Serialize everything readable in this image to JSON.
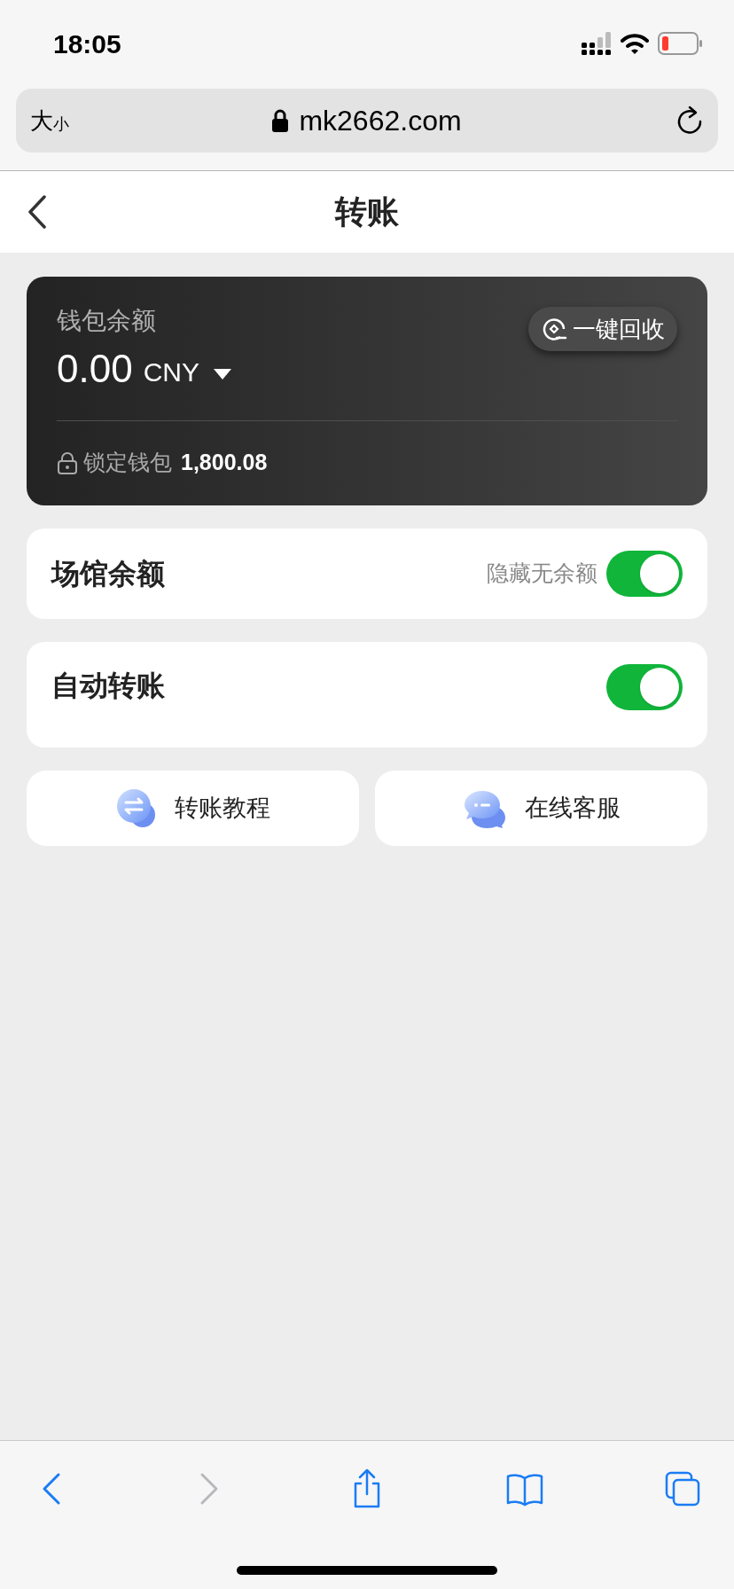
{
  "status_bar": {
    "time": "18:05"
  },
  "address_bar": {
    "text_size": "大",
    "text_size_small": "小",
    "url": "mk2662.com"
  },
  "header": {
    "title": "转账"
  },
  "wallet": {
    "label": "钱包余额",
    "amount": "0.00",
    "currency": "CNY",
    "recall_button": "一键回收",
    "locked_label": "锁定钱包",
    "locked_amount": "1,800.08"
  },
  "settings": [
    {
      "label": "场馆余额",
      "hint": "隐藏无余额",
      "on": true
    },
    {
      "label": "自动转账",
      "on": true
    }
  ],
  "actions": [
    {
      "label": "转账教程",
      "kind": "tutorial"
    },
    {
      "label": "在线客服",
      "kind": "support"
    }
  ],
  "toolbar": [
    {
      "kind": "back",
      "disabled": false
    },
    {
      "kind": "forward",
      "disabled": true
    },
    {
      "kind": "share",
      "disabled": false
    },
    {
      "kind": "bookmarks",
      "disabled": false
    },
    {
      "kind": "tabs",
      "disabled": false
    }
  ]
}
